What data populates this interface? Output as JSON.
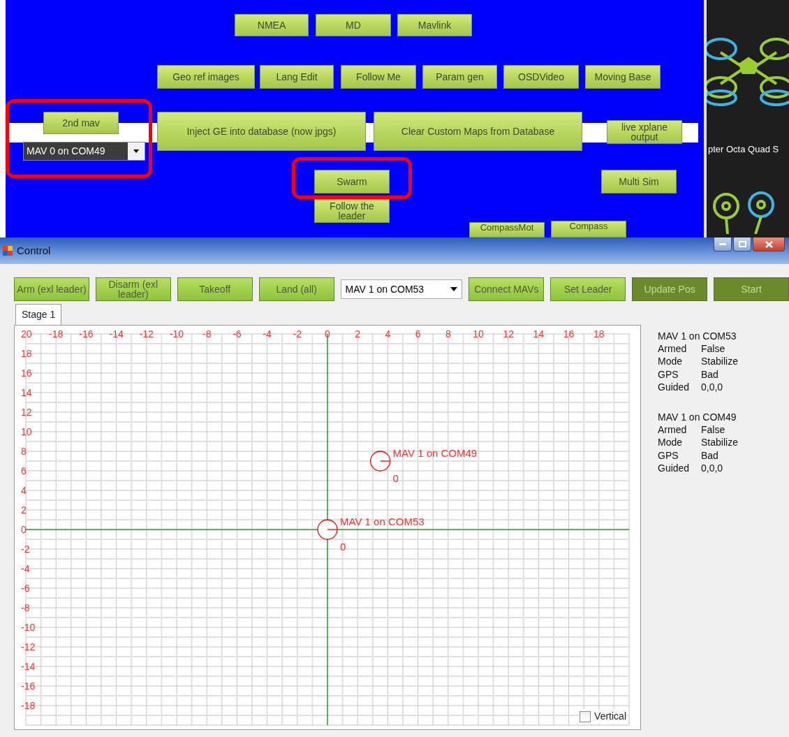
{
  "top_panel": {
    "buttons": [
      {
        "label": "NMEA"
      },
      {
        "label": "MD"
      },
      {
        "label": "Mavlink"
      },
      {
        "label": "Geo ref images"
      },
      {
        "label": "Lang Edit"
      },
      {
        "label": "Follow Me"
      },
      {
        "label": "Param gen"
      },
      {
        "label": "OSDVideo"
      },
      {
        "label": "Moving Base"
      },
      {
        "label": "2nd mav"
      },
      {
        "label": "Inject GE into database (now jpgs)"
      },
      {
        "label": "Clear Custom Maps from Database"
      },
      {
        "label": "live xplane output"
      },
      {
        "label": "Swarm"
      },
      {
        "label": "Multi Sim"
      },
      {
        "label": "Follow the leader"
      },
      {
        "label": "CompassMot"
      },
      {
        "label": "Compass"
      }
    ],
    "mav_select": {
      "value": "MAV 0 on COM49"
    },
    "side_caption": "pter Octa Quad S"
  },
  "window": {
    "title": "Control"
  },
  "toolbar": [
    {
      "kind": "button",
      "label": "Arm (exl leader)",
      "disabled": false
    },
    {
      "kind": "button",
      "label": "Disarm (exl leader)",
      "disabled": false
    },
    {
      "kind": "button",
      "label": "Takeoff",
      "disabled": false
    },
    {
      "kind": "button",
      "label": "Land (all)",
      "disabled": false
    },
    {
      "kind": "select",
      "label": "MAV 1 on COM53",
      "disabled": false
    },
    {
      "kind": "button",
      "label": "Connect MAVs",
      "disabled": false
    },
    {
      "kind": "button",
      "label": "Set Leader",
      "disabled": false
    },
    {
      "kind": "button",
      "label": "Update Pos",
      "disabled": true
    },
    {
      "kind": "button",
      "label": "Start",
      "disabled": true
    }
  ],
  "tabs": [
    {
      "label": "Stage 1",
      "selected": true
    }
  ],
  "plot": {
    "chart_data": {
      "type": "scatter",
      "x": [
        0,
        3.5
      ],
      "series": [
        {
          "color": "#ff0000",
          "values": [
            0,
            7
          ]
        }
      ],
      "xlim": [
        -20,
        20
      ],
      "ylim": [
        -20,
        20
      ],
      "grid": true,
      "xticks": [
        -18,
        -16,
        -14,
        -12,
        -10,
        -8,
        -6,
        -4,
        -2,
        0,
        2,
        4,
        6,
        8,
        10,
        12,
        14,
        16,
        18
      ],
      "yticks": [
        -18,
        -16,
        -14,
        -12,
        -10,
        -8,
        -6,
        -4,
        -2,
        0,
        2,
        4,
        6,
        8,
        10,
        12,
        14,
        16,
        18,
        20
      ],
      "annotations": [
        "MAV 1 on COM53",
        "0",
        "MAV 1 on COM49",
        "0"
      ]
    },
    "vertical": {
      "label": "Vertical",
      "checked": false
    }
  },
  "status": [
    {
      "title": "MAV 1 on COM53",
      "fields": [
        {
          "label": "Armed",
          "value": "False"
        },
        {
          "label": "Mode",
          "value": "Stabilize"
        },
        {
          "label": "GPS",
          "value": "Bad"
        },
        {
          "label": "Guided",
          "value": "0,0,0"
        }
      ]
    },
    {
      "title": "MAV 1 on COM49",
      "fields": [
        {
          "label": "Armed",
          "value": "False"
        },
        {
          "label": "Mode",
          "value": "Stabilize"
        },
        {
          "label": "GPS",
          "value": "Bad"
        },
        {
          "label": "Guided",
          "value": "0,0,0"
        }
      ]
    }
  ]
}
